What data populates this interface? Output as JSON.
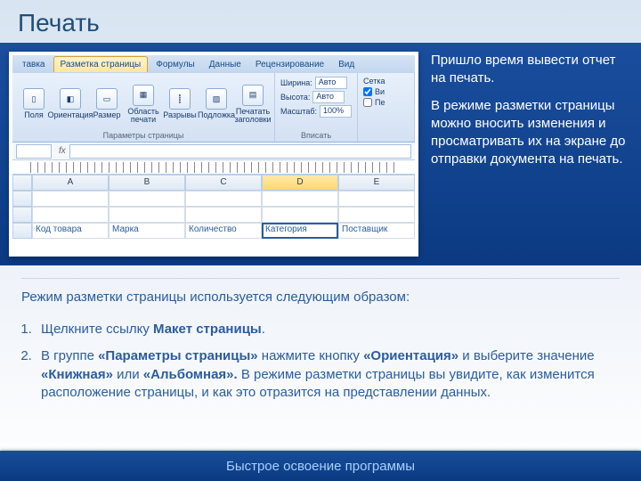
{
  "title": "Печать",
  "right": {
    "p1": "Пришло время вывести отчет на печать.",
    "p2": "В режиме разметки страницы можно вносить изменения и просматривать их на экране до отправки документа на печать."
  },
  "excel": {
    "tabs": [
      "тавка",
      "Разметка страницы",
      "Формулы",
      "Данные",
      "Рецензирование",
      "Вид"
    ],
    "group1_name": "Параметры страницы",
    "btn_fields": "Поля",
    "btn_orient": "Ориентация",
    "btn_size": "Размер",
    "btn_area": "Область печати",
    "btn_breaks": "Разрывы",
    "btn_bg": "Подложка",
    "btn_titles": "Печатать заголовки",
    "width_label": "Ширина:",
    "height_label": "Высота:",
    "scale_label": "Масштаб:",
    "auto": "Авто",
    "scale_val": "100%",
    "group2_name": "Вписать",
    "grid_label": "Сетка",
    "view_label": "Ви",
    "print_label": "Пе",
    "cols": [
      "A",
      "B",
      "C",
      "D",
      "E"
    ],
    "headers": [
      "Код товара",
      "Марка",
      "Количество",
      "Категория",
      "Поставщик"
    ],
    "sel_col_idx": 3
  },
  "mid_caption": "Режим разметки страницы используется следующим образом:",
  "steps": {
    "s1_a": "Щелкните ссылку ",
    "s1_b": "Макет страницы",
    "s1_c": ".",
    "s2_a": "В группе ",
    "s2_b": "«Параметры страницы»",
    "s2_c": " нажмите кнопку ",
    "s2_d": "«Ориентация»",
    "s2_e": " и выберите значение ",
    "s2_f": "«Книжная»",
    "s2_g": " или ",
    "s2_h": "«Альбомная».",
    "s2_i": " В режиме разметки страницы вы увидите, как изменится расположение страницы, и как это отразится на представлении данных."
  },
  "footer": "Быстрое освоение программы"
}
